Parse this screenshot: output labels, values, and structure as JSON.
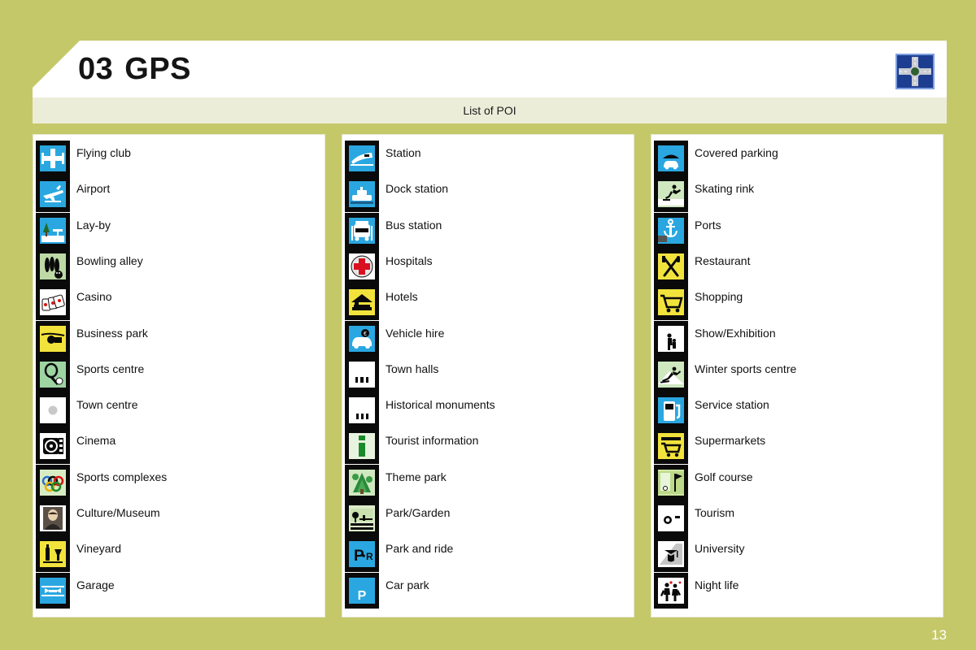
{
  "header": {
    "chapter_number": "03",
    "title": "GPS",
    "logo_icon": "road-junction-icon",
    "subtitle": "List of POI"
  },
  "page_number": "13",
  "colors": {
    "background": "#c5c868",
    "panel": "#ffffff",
    "band": "#ecedd9",
    "icon_tile": "#0a0a0a",
    "logo_blue": "#1d3d91",
    "page_number": "#ffffff"
  },
  "columns": [
    {
      "id": "column-0",
      "items": [
        {
          "label": "Flying club",
          "icon": "flying-club-icon",
          "tint": "#2aa7e0"
        },
        {
          "label": "Airport",
          "icon": "airport-icon",
          "tint": "#2aa7e0"
        },
        {
          "label": "Lay-by",
          "icon": "lay-by-icon",
          "tint": "#2aa7e0"
        },
        {
          "label": "Bowling alley",
          "icon": "bowling-alley-icon",
          "tint": "#bcd9a6"
        },
        {
          "label": "Casino",
          "icon": "casino-icon",
          "tint": "#ffffff"
        },
        {
          "label": "Business park",
          "icon": "business-park-icon",
          "tint": "#f2e33c"
        },
        {
          "label": "Sports centre",
          "icon": "sports-centre-icon",
          "tint": "#9ed3a2"
        },
        {
          "label": "Town centre",
          "icon": "town-centre-icon",
          "tint": "#ffffff"
        },
        {
          "label": "Cinema",
          "icon": "cinema-icon",
          "tint": "#ffffff"
        },
        {
          "label": "Sports complexes",
          "icon": "sports-complexes-icon",
          "tint": "#d8ecc4"
        },
        {
          "label": "Culture/Museum",
          "icon": "culture-museum-icon",
          "tint": "#ffffff"
        },
        {
          "label": "Vineyard",
          "icon": "vineyard-icon",
          "tint": "#f2e33c"
        },
        {
          "label": "Garage",
          "icon": "garage-icon",
          "tint": "#2aa7e0"
        }
      ]
    },
    {
      "id": "column-1",
      "items": [
        {
          "label": "Station",
          "icon": "station-icon",
          "tint": "#2aa7e0"
        },
        {
          "label": "Dock station",
          "icon": "dock-station-icon",
          "tint": "#2aa7e0"
        },
        {
          "label": "Bus station",
          "icon": "bus-station-icon",
          "tint": "#2aa7e0"
        },
        {
          "label": "Hospitals",
          "icon": "hospital-icon",
          "tint": "#ffffff"
        },
        {
          "label": "Hotels",
          "icon": "hotel-icon",
          "tint": "#f2e33c"
        },
        {
          "label": "Vehicle hire",
          "icon": "vehicle-hire-icon",
          "tint": "#2aa7e0"
        },
        {
          "label": "Town halls",
          "icon": "town-hall-icon",
          "tint": "#ffffff"
        },
        {
          "label": "Historical monuments",
          "icon": "historical-monument-icon",
          "tint": "#ffffff"
        },
        {
          "label": "Tourist information",
          "icon": "tourist-information-icon",
          "tint": "#e8f3df"
        },
        {
          "label": "Theme park",
          "icon": "theme-park-icon",
          "tint": "#cfe8c0"
        },
        {
          "label": "Park/Garden",
          "icon": "park-garden-icon",
          "tint": "#dcecc9"
        },
        {
          "label": "Park and ride",
          "icon": "park-and-ride-icon",
          "tint": "#2aa7e0"
        },
        {
          "label": "Car park",
          "icon": "car-park-icon",
          "tint": "#2aa7e0"
        }
      ]
    },
    {
      "id": "column-2",
      "items": [
        {
          "label": "Covered parking",
          "icon": "covered-parking-icon",
          "tint": "#2aa7e0"
        },
        {
          "label": "Skating rink",
          "icon": "skating-rink-icon",
          "tint": "#cfe8c0"
        },
        {
          "label": "Ports",
          "icon": "port-icon",
          "tint": "#2aa7e0"
        },
        {
          "label": "Restaurant",
          "icon": "restaurant-icon",
          "tint": "#f2e33c"
        },
        {
          "label": "Shopping",
          "icon": "shopping-icon",
          "tint": "#f2e33c"
        },
        {
          "label": "Show/Exhibition",
          "icon": "show-exhibition-icon",
          "tint": "#ffffff"
        },
        {
          "label": "Winter sports centre",
          "icon": "winter-sports-icon",
          "tint": "#cfe8c0"
        },
        {
          "label": "Service station",
          "icon": "service-station-icon",
          "tint": "#2aa7e0"
        },
        {
          "label": "Supermarkets",
          "icon": "supermarket-icon",
          "tint": "#f2e33c"
        },
        {
          "label": "Golf course",
          "icon": "golf-course-icon",
          "tint": "#cfe8a0"
        },
        {
          "label": "Tourism",
          "icon": "tourism-icon",
          "tint": "#ffffff"
        },
        {
          "label": "University",
          "icon": "university-icon",
          "tint": "#ffffff"
        },
        {
          "label": "Night life",
          "icon": "night-life-icon",
          "tint": "#ffffff"
        }
      ]
    }
  ]
}
